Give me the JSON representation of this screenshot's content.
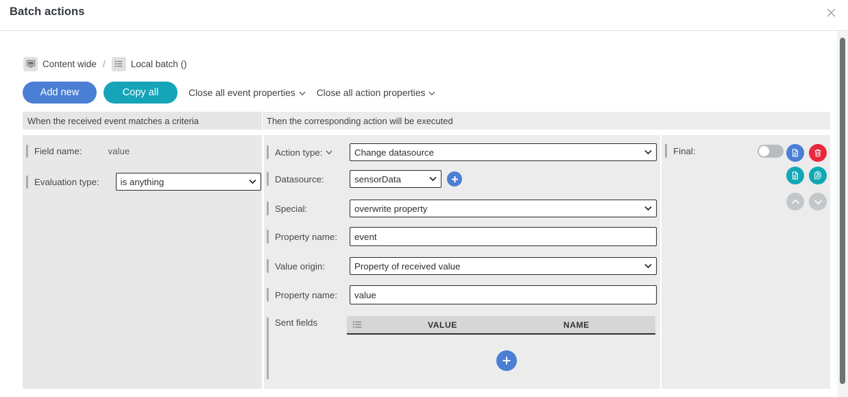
{
  "window": {
    "title": "Batch actions",
    "close_icon": "close-icon"
  },
  "breadcrumb": {
    "items": [
      {
        "icon": "monitor-icon",
        "label": "Content wide"
      },
      {
        "icon": "list-icon",
        "label": "Local batch ()"
      }
    ],
    "separator": "/"
  },
  "toolbar": {
    "add_new_label": "Add new",
    "copy_all_label": "Copy all",
    "close_event_props_label": "Close all event properties",
    "close_action_props_label": "Close all action properties"
  },
  "columns": {
    "event_header": "When the received event matches a criteria",
    "action_header": "Then the corresponding action will be executed"
  },
  "event_panel": {
    "field_name_label": "Field name:",
    "field_name_value": "value",
    "evaluation_type_label": "Evaluation type:",
    "evaluation_type_value": "is anything"
  },
  "action_panel": {
    "action_type_label": "Action type:",
    "action_type_value": "Change datasource",
    "datasource_label": "Datasource:",
    "datasource_value": "sensorData",
    "datasource_add_icon": "plus-icon",
    "special_label": "Special:",
    "special_value": "overwrite property",
    "property_name_1_label": "Property name:",
    "property_name_1_value": "event",
    "value_origin_label": "Value origin:",
    "value_origin_value": "Property of received value",
    "property_name_2_label": "Property name:",
    "property_name_2_value": "value",
    "sent_fields_label": "Sent fields",
    "sent_fields_table": {
      "menu_icon": "list-icon",
      "columns": [
        "VALUE",
        "NAME"
      ],
      "rows": []
    },
    "sent_fields_add_icon": "plus-icon"
  },
  "final_panel": {
    "final_label": "Final:",
    "toggle_state": "off",
    "buttons": [
      {
        "name": "copy-action-button",
        "icon": "document-copy-icon",
        "color": "#4a7fd4"
      },
      {
        "name": "delete-action-button",
        "icon": "trash-icon",
        "color": "#e8283c"
      },
      {
        "name": "paste-action-button",
        "icon": "document-icon",
        "color": "#10a8b5"
      },
      {
        "name": "duplicate-action-button",
        "icon": "documents-icon",
        "color": "#10a8b5"
      },
      {
        "name": "move-up-button",
        "icon": "chevron-up-icon",
        "color": "#c4c7c9"
      },
      {
        "name": "move-down-button",
        "icon": "chevron-down-icon",
        "color": "#c4c7c9"
      }
    ]
  },
  "colors": {
    "primary_blue": "#4a7fd4",
    "teal": "#16a4b8",
    "danger_red": "#e8283c",
    "panel_gray": "#e8e8e8"
  }
}
